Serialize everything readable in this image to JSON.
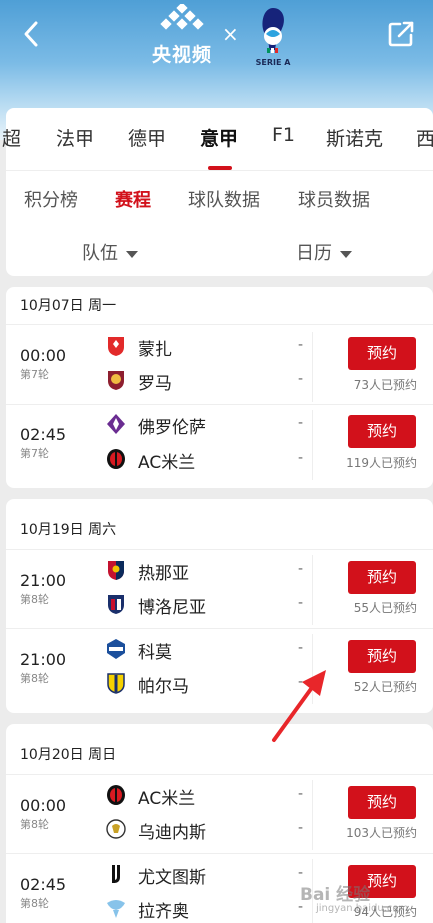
{
  "header": {
    "broadcaster": "央视频",
    "times_sign": "×",
    "league_logo_text": "SERIE A"
  },
  "league_tabs": [
    {
      "label": "超"
    },
    {
      "label": "法甲"
    },
    {
      "label": "德甲"
    },
    {
      "label": "意甲"
    },
    {
      "label": "F1"
    },
    {
      "label": "斯诺克"
    },
    {
      "label": "西"
    }
  ],
  "active_league_tab": "意甲",
  "sub_tabs": [
    {
      "label": "积分榜"
    },
    {
      "label": "赛程"
    },
    {
      "label": "球队数据"
    },
    {
      "label": "球员数据"
    }
  ],
  "active_sub_tab": "赛程",
  "filters": {
    "team": "队伍",
    "calendar": "日历"
  },
  "groups": [
    {
      "date": "10月07日 周一",
      "matches": [
        {
          "time": "00:00",
          "round": "第7轮",
          "home": "蒙扎",
          "away": "罗马",
          "home_score": "-",
          "away_score": "-",
          "button": "预约",
          "count": "73人已预约"
        },
        {
          "time": "02:45",
          "round": "第7轮",
          "home": "佛罗伦萨",
          "away": "AC米兰",
          "home_score": "-",
          "away_score": "-",
          "button": "预约",
          "count": "119人已预约"
        }
      ]
    },
    {
      "date": "10月19日 周六",
      "matches": [
        {
          "time": "21:00",
          "round": "第8轮",
          "home": "热那亚",
          "away": "博洛尼亚",
          "home_score": "-",
          "away_score": "-",
          "button": "预约",
          "count": "55人已预约"
        },
        {
          "time": "21:00",
          "round": "第8轮",
          "home": "科莫",
          "away": "帕尔马",
          "home_score": "-",
          "away_score": "-",
          "button": "预约",
          "count": "52人已预约"
        }
      ]
    },
    {
      "date": "10月20日 周日",
      "matches": [
        {
          "time": "00:00",
          "round": "第8轮",
          "home": "AC米兰",
          "away": "乌迪内斯",
          "home_score": "-",
          "away_score": "-",
          "button": "预约",
          "count": "103人已预约"
        },
        {
          "time": "02:45",
          "round": "第8轮",
          "home": "尤文图斯",
          "away": "拉齐奥",
          "home_score": "-",
          "away_score": "-",
          "button": "预约",
          "count": "94人已预约"
        }
      ]
    }
  ],
  "watermark": {
    "main": "Bai 经验",
    "sub": "jingyan.baidu.com"
  },
  "colors": {
    "accent": "#d2111b",
    "header_top": "#4f9fd6",
    "background": "#ececec"
  }
}
